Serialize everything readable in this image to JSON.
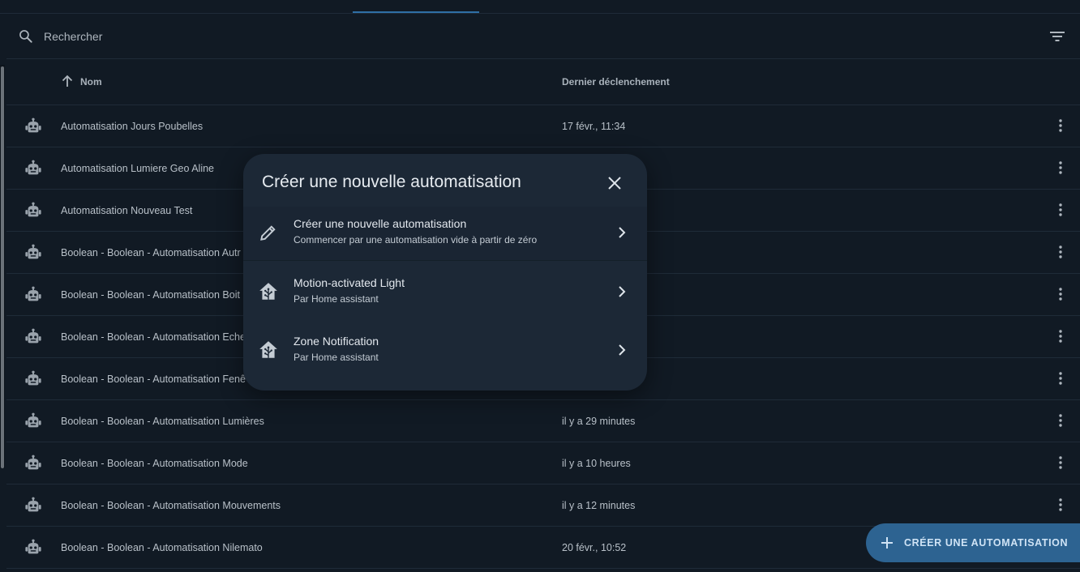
{
  "search": {
    "placeholder": "Rechercher",
    "value": ""
  },
  "table": {
    "columns": {
      "name": "Nom",
      "last_trigger": "Dernier déclenchement"
    },
    "rows": [
      {
        "name": "Automatisation Jours Poubelles",
        "last_trigger": "17 févr., 11:34"
      },
      {
        "name": "Automatisation Lumiere Geo Aline",
        "last_trigger": ""
      },
      {
        "name": "Automatisation Nouveau Test",
        "last_trigger": ""
      },
      {
        "name": "Boolean - Boolean - Automatisation Autr",
        "last_trigger": ""
      },
      {
        "name": "Boolean - Boolean - Automatisation Boit",
        "last_trigger": ""
      },
      {
        "name": "Boolean - Boolean - Automatisation Eche",
        "last_trigger": ""
      },
      {
        "name": "Boolean - Boolean - Automatisation Fenê",
        "last_trigger": ""
      },
      {
        "name": "Boolean - Boolean - Automatisation Lumières",
        "last_trigger": "il y a 29 minutes"
      },
      {
        "name": "Boolean - Boolean - Automatisation Mode",
        "last_trigger": "il y a 10 heures"
      },
      {
        "name": "Boolean - Boolean - Automatisation Mouvements",
        "last_trigger": "il y a 12 minutes"
      },
      {
        "name": "Boolean - Boolean - Automatisation Nilemato",
        "last_trigger": "20 févr., 10:52"
      }
    ]
  },
  "dialog": {
    "title": "Créer une nouvelle automatisation",
    "options": [
      {
        "title": "Créer une nouvelle automatisation",
        "subtitle": "Commencer par une automatisation vide à partir de zéro",
        "icon": "pencil-icon"
      },
      {
        "title": "Motion-activated Light",
        "subtitle": "Par Home assistant",
        "icon": "home-assistant-icon"
      },
      {
        "title": "Zone Notification",
        "subtitle": "Par Home assistant",
        "icon": "home-assistant-icon"
      }
    ]
  },
  "fab": {
    "label": "CRÉER UNE AUTOMATISATION"
  },
  "colors": {
    "background": "#111a24",
    "dialog": "#1c2836",
    "accent": "#2d6391",
    "tab_indicator": "#2f6fa6"
  }
}
